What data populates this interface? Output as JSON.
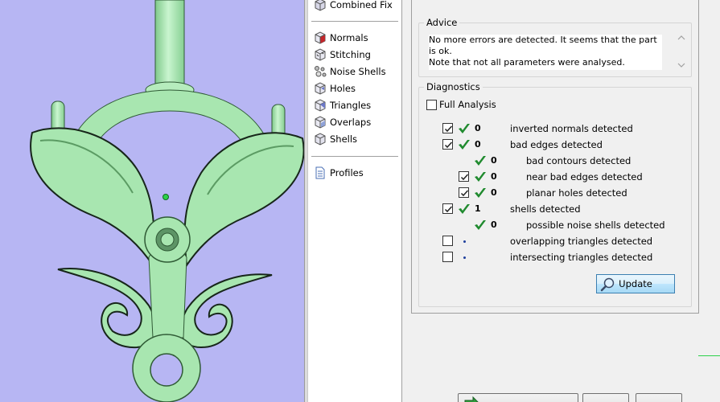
{
  "nav": {
    "items": [
      {
        "label": "Combined Fix",
        "icon": "combined-fix-icon"
      },
      {
        "label": "Normals",
        "icon": "normals-icon"
      },
      {
        "label": "Stitching",
        "icon": "stitching-icon"
      },
      {
        "label": "Noise Shells",
        "icon": "noise-shells-icon"
      },
      {
        "label": "Holes",
        "icon": "holes-icon"
      },
      {
        "label": "Triangles",
        "icon": "triangles-icon"
      },
      {
        "label": "Overlaps",
        "icon": "overlaps-icon"
      },
      {
        "label": "Shells",
        "icon": "shells-icon"
      },
      {
        "label": "Profiles",
        "icon": "profiles-icon"
      }
    ]
  },
  "advice": {
    "title": "Advice",
    "line1": "No more errors are detected. It seems that the part is ok.",
    "line2": "Note that not all parameters were analysed."
  },
  "diagnostics": {
    "title": "Diagnostics",
    "full_analysis_label": "Full Analysis",
    "full_analysis_checked": false,
    "rows": [
      {
        "checked": true,
        "status": "ok",
        "count": "0",
        "label": "inverted normals detected"
      },
      {
        "checked": true,
        "status": "ok",
        "count": "0",
        "label": "bad edges detected"
      },
      {
        "checked": null,
        "status": "ok",
        "count": "0",
        "label": "bad contours detected"
      },
      {
        "checked": true,
        "status": "ok",
        "count": "0",
        "label": "near bad edges detected"
      },
      {
        "checked": true,
        "status": "ok",
        "count": "0",
        "label": "planar holes detected"
      },
      {
        "checked": true,
        "status": "ok",
        "count": "1",
        "label": "shells detected"
      },
      {
        "checked": null,
        "status": "ok",
        "count": "0",
        "label": "possible noise shells detected"
      },
      {
        "checked": false,
        "status": "none",
        "count": "",
        "label": "overlapping triangles detected"
      },
      {
        "checked": false,
        "status": "none",
        "count": "",
        "label": "intersecting triangles detected"
      }
    ],
    "update_label": "Update"
  },
  "colors": {
    "viewport_bg": "#b7b6f3",
    "model_fill": "#a8e6b0",
    "check_green": "#1f8a2e",
    "dot_blue": "#1e3f9c"
  }
}
